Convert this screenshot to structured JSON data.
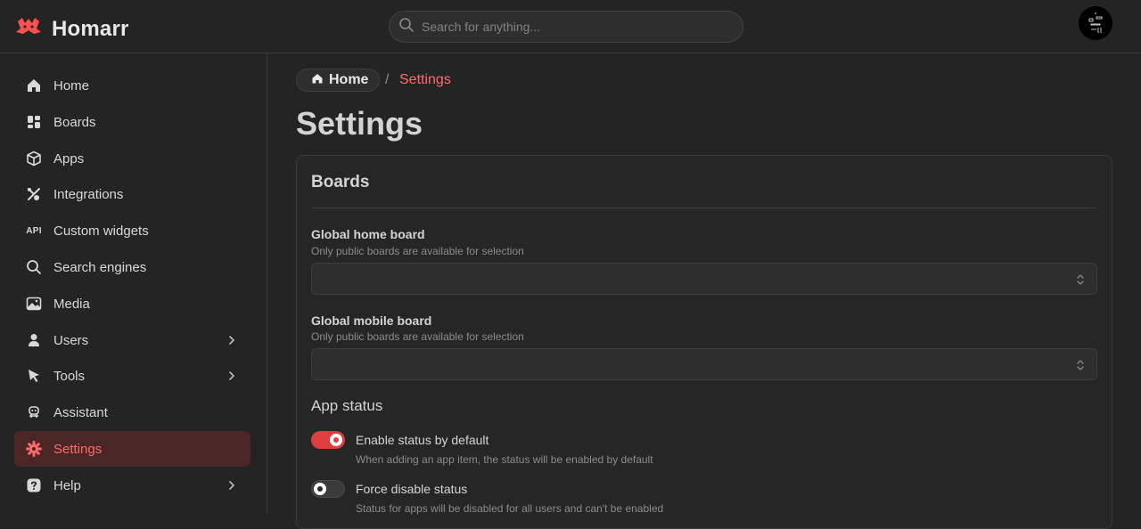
{
  "header": {
    "logo_text": "Homarr",
    "search_placeholder": "Search for anything...",
    "accent_color": "#fa5252"
  },
  "sidebar": {
    "items": [
      {
        "label": "Home",
        "icon": "home-icon"
      },
      {
        "label": "Boards",
        "icon": "boards-icon"
      },
      {
        "label": "Apps",
        "icon": "box-icon"
      },
      {
        "label": "Integrations",
        "icon": "plug-icon"
      },
      {
        "label": "Custom widgets",
        "icon": "api-icon",
        "icon_text": "API"
      },
      {
        "label": "Search engines",
        "icon": "search-icon"
      },
      {
        "label": "Media",
        "icon": "photo-icon"
      },
      {
        "label": "Users",
        "icon": "user-icon",
        "expandable": true
      },
      {
        "label": "Tools",
        "icon": "pointer-icon",
        "expandable": true
      },
      {
        "label": "Assistant",
        "icon": "robot-icon"
      },
      {
        "label": "Settings",
        "icon": "gear-icon",
        "active": true
      },
      {
        "label": "Help",
        "icon": "help-icon",
        "expandable": true
      }
    ]
  },
  "breadcrumb": {
    "home": "Home",
    "separator": "/",
    "current": "Settings"
  },
  "page": {
    "title": "Settings"
  },
  "boards_card": {
    "title": "Boards",
    "home_board": {
      "label": "Global home board",
      "description": "Only public boards are available for selection",
      "value": ""
    },
    "mobile_board": {
      "label": "Global mobile board",
      "description": "Only public boards are available for selection",
      "value": ""
    },
    "app_status": {
      "title": "App status",
      "enable_status": {
        "label": "Enable status by default",
        "description": "When adding an app item, the status will be enabled by default",
        "checked": true
      },
      "force_disable": {
        "label": "Force disable status",
        "description": "Status for apps will be disabled for all users and can't be enabled",
        "checked": false
      }
    }
  }
}
